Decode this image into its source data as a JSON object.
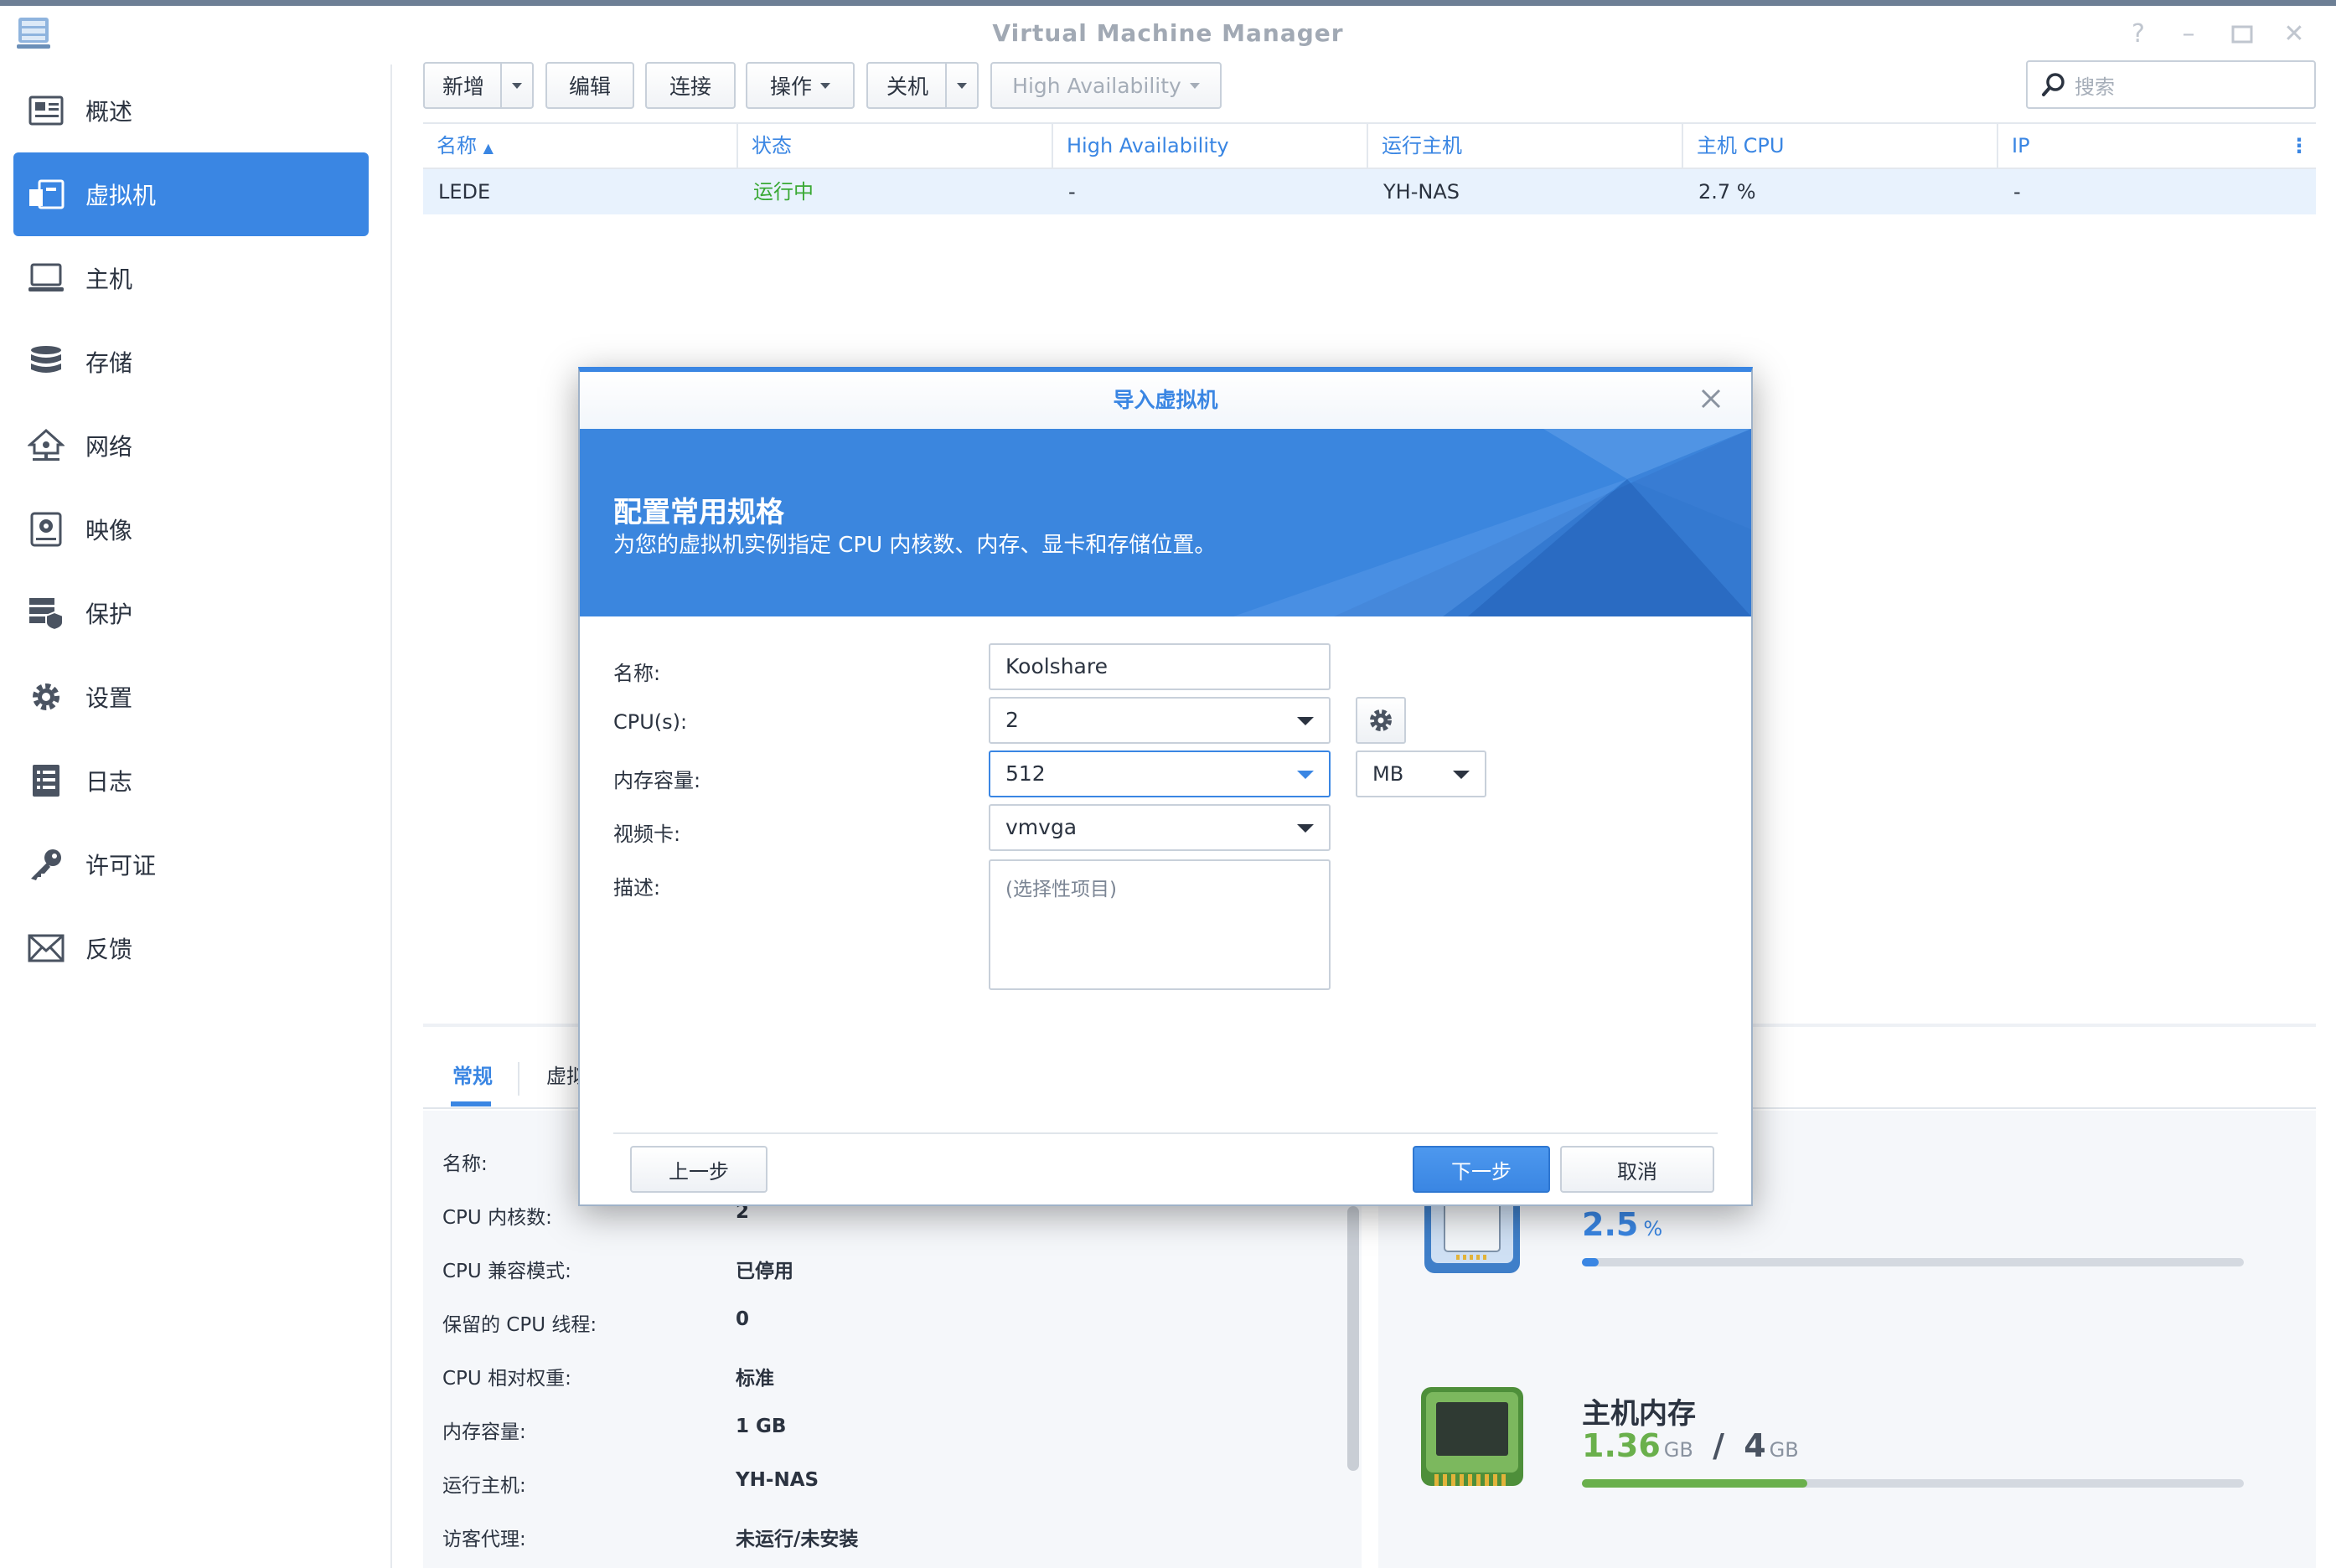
{
  "window": {
    "title": "Virtual Machine Manager"
  },
  "sidebar": {
    "items": [
      {
        "label": "概述",
        "icon": "overview-icon"
      },
      {
        "label": "虚拟机",
        "icon": "virtual-machine-icon",
        "active": true
      },
      {
        "label": "主机",
        "icon": "host-icon"
      },
      {
        "label": "存储",
        "icon": "storage-icon"
      },
      {
        "label": "网络",
        "icon": "network-icon"
      },
      {
        "label": "映像",
        "icon": "image-icon"
      },
      {
        "label": "保护",
        "icon": "protection-icon"
      },
      {
        "label": "设置",
        "icon": "settings-icon"
      },
      {
        "label": "日志",
        "icon": "log-icon"
      },
      {
        "label": "许可证",
        "icon": "license-icon"
      },
      {
        "label": "反馈",
        "icon": "feedback-icon"
      }
    ]
  },
  "toolbar": {
    "create": "新增",
    "edit": "编辑",
    "connect": "连接",
    "action": "操作",
    "shutdown": "关机",
    "ha": "High Availability",
    "search_placeholder": "搜索"
  },
  "grid": {
    "columns": [
      "名称",
      "状态",
      "High Availability",
      "运行主机",
      "主机 CPU",
      "IP"
    ],
    "rows": [
      {
        "name": "LEDE",
        "status": "运行中",
        "ha": "-",
        "host": "YH-NAS",
        "cpu": "2.7 %",
        "ip": "-"
      }
    ]
  },
  "details": {
    "tabs": [
      "常规",
      "虚拟"
    ],
    "info": [
      {
        "label": "名称:",
        "value": ""
      },
      {
        "label": "CPU 内核数:",
        "value": "2"
      },
      {
        "label": "CPU 兼容模式:",
        "value": "已停用"
      },
      {
        "label": "保留的 CPU 线程:",
        "value": "0"
      },
      {
        "label": "CPU 相对权重:",
        "value": "标准"
      },
      {
        "label": "内存容量:",
        "value": "1 GB"
      },
      {
        "label": "运行主机:",
        "value": "YH-NAS"
      },
      {
        "label": "访客代理:",
        "value": "未运行/未安装"
      }
    ],
    "cpu_stat": {
      "value": "2.5",
      "unit": "%",
      "fraction": 0.025,
      "color": "#3a86e3"
    },
    "memory_stat": {
      "title": "主机内存",
      "used": "1.36",
      "used_unit": "GB",
      "separator": "/",
      "total": "4",
      "total_unit": "GB",
      "fraction": 0.34,
      "color": "#6ab04c"
    }
  },
  "modal": {
    "title": "导入虚拟机",
    "banner_title": "配置常用规格",
    "banner_subtitle": "为您的虚拟机实例指定 CPU 内核数、内存、显卡和存储位置。",
    "fields": {
      "name_label": "名称:",
      "name_value": "Koolshare",
      "cpu_label": "CPU(s):",
      "cpu_value": "2",
      "memory_label": "内存容量:",
      "memory_value": "512",
      "memory_unit": "MB",
      "video_label": "视频卡:",
      "video_value": "vmvga",
      "desc_label": "描述:",
      "desc_placeholder": "(选择性项目)"
    },
    "buttons": {
      "prev": "上一步",
      "next": "下一步",
      "cancel": "取消"
    }
  },
  "colors": {
    "accent": "#3a86e3",
    "running": "#3aa935",
    "memory": "#6ab04c"
  }
}
